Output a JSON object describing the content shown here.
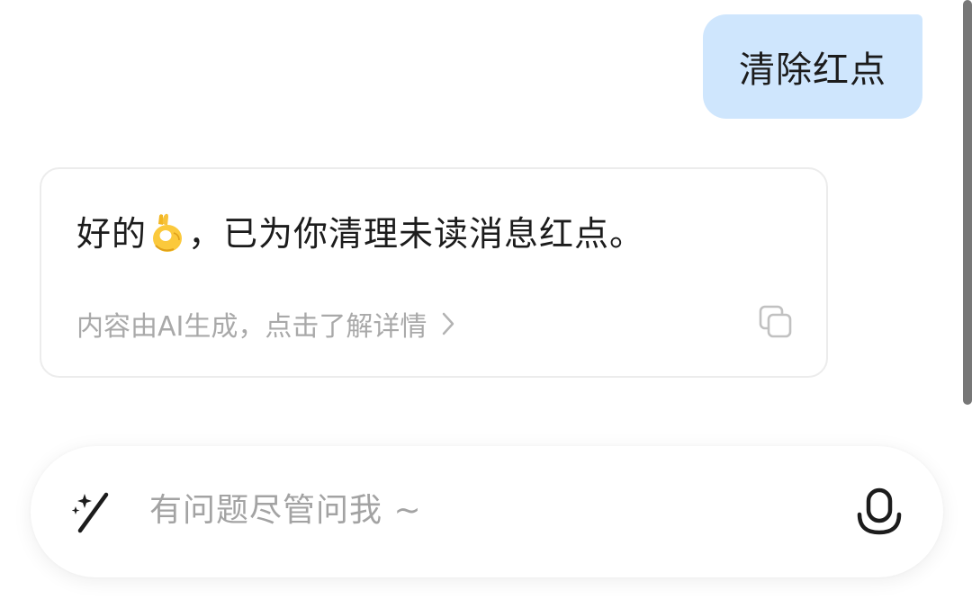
{
  "conversation": {
    "user_message": "清除红点",
    "ai_message": {
      "prefix": "好的",
      "emoji": "ok-hand-emoji",
      "suffix": "，已为你清理未读消息红点。",
      "footer_note": "内容由AI生成，点击了解详情"
    }
  },
  "input_bar": {
    "placeholder": "有问题尽管问我 ~"
  },
  "colors": {
    "user_bubble_bg": "#cfe6fd",
    "text_primary": "#1c1c1c",
    "text_muted": "#a9a9a9",
    "scrollbar": "#777777"
  },
  "icons": [
    "ok-hand-emoji",
    "chevron-right-icon",
    "copy-icon",
    "magic-wand-icon",
    "microphone-icon"
  ]
}
